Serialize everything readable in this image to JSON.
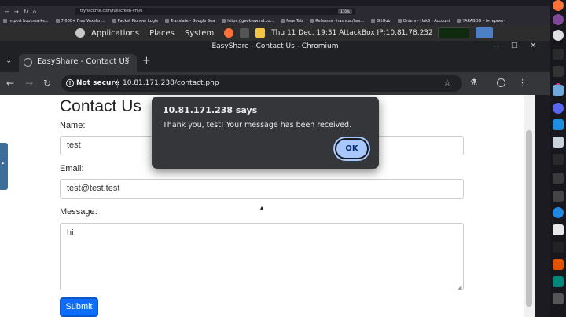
{
  "firefox": {
    "url": "tryhackme.com/fullscreen-vm/0",
    "zoom": "170%",
    "bookmarks": [
      "Import bookmarks...",
      "7,000+ Free Vexelsn...",
      "Packet Pioneer Logis",
      "Translate - Google Sea",
      "https://geekrewind.co...",
      "New Tab",
      "Releases · hashcat/has...",
      "GitHub",
      "Orders - Hak5 - Account",
      "YAKABOO – інтернет-"
    ]
  },
  "vm_panel": {
    "menus": [
      "Applications",
      "Places",
      "System"
    ],
    "status": "Thu 11 Dec, 19:31 AttackBox IP:10.81.78.232"
  },
  "chromium": {
    "window_title": "EasyShare - Contact Us - Chromium",
    "tab_title": "EasyShare - Contact Us",
    "security_label": "Not secure",
    "url": "10.81.171.238/contact.php"
  },
  "page": {
    "heading": "Contact Us",
    "name_label": "Name:",
    "name_value": "test",
    "email_label": "Email:",
    "email_value": "test@test.test",
    "message_label": "Message:",
    "message_value": "hi",
    "submit_label": "Submit"
  },
  "dialog": {
    "title": "10.81.171.238 says",
    "message": "Thank you, test! Your message has been received.",
    "ok_label": "OK"
  },
  "colors": {
    "accent_blue": "#0d6efd",
    "dialog_bg": "#35363a",
    "ok_button": "#a8c7fa"
  }
}
